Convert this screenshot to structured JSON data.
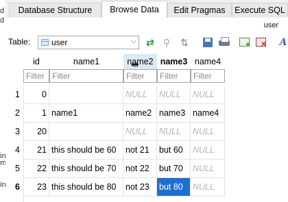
{
  "background_fragments": [
    "d",
    "d",
    "in",
    "ma",
    "ins"
  ],
  "tabs": [
    "Database Structure",
    "Browse Data",
    "Edit Pragmas",
    "Execute SQL"
  ],
  "active_tab": 1,
  "top_right_label": "user",
  "toolbar": {
    "table_label": "Table:",
    "table_value": "user"
  },
  "grid": {
    "columns": [
      "id",
      "name1",
      "name2",
      "name3",
      "name4"
    ],
    "bold_column": "name3",
    "filter_placeholder": "Filter",
    "null_text": "NULL",
    "rows": [
      {
        "row_num": "1",
        "cells": [
          "0",
          null,
          null,
          null,
          null
        ]
      },
      {
        "row_num": "2",
        "cells": [
          "1",
          "name1",
          "name2",
          "name3",
          "name4"
        ]
      },
      {
        "row_num": "3",
        "cells": [
          "20",
          null,
          null,
          null,
          null
        ]
      },
      {
        "row_num": "4",
        "cells": [
          "21",
          "this should be 60",
          "not 21",
          "but 60",
          null
        ]
      },
      {
        "row_num": "5",
        "cells": [
          "22",
          "this should be 70",
          "not 22",
          "but 70",
          null
        ]
      },
      {
        "row_num": "6",
        "cells": [
          "23",
          "this should be 80",
          "not 23",
          "but 80",
          null
        ]
      }
    ],
    "current_row": 6,
    "selected_cell": {
      "row": 6,
      "column": "name3"
    },
    "empty_name1_rows": [
      1,
      3
    ]
  }
}
